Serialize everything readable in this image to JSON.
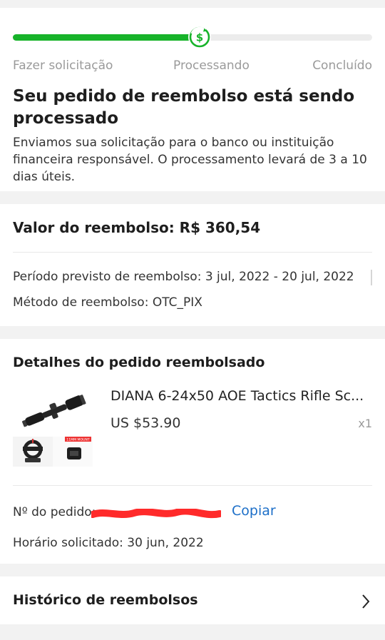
{
  "status": {
    "steps": [
      "Fazer solicitação",
      "Processando",
      "Concluído"
    ],
    "progress_fraction": 0.52,
    "title": "Seu pedido de reembolso está sendo processado",
    "description": "Enviamos sua solicitação para o banco ou instituição financeira responsável. O processamento levará de 3 a 10 dias úteis.",
    "icon": "dollar-refund-icon",
    "accent_color": "#17b32a"
  },
  "refund": {
    "amount_label": "Valor do reembolso: R$ 360,54",
    "period_label": "Período previsto de reembolso: 3 jul, 2022 - 20 jul, 2022",
    "method_label": "Método de reembolso: OTC_PIX"
  },
  "order": {
    "section_title": "Detalhes do pedido reembolsado",
    "product_name": "DIANA 6-24x50 AOE Tactics Rifle Sc...",
    "product_price": "US $53.90",
    "product_qty": "x1",
    "thumb_caption": "11MM MOUNT",
    "order_number_label": "Nº do pedido:",
    "copy_label": "Copiar",
    "requested_label": "Horário solicitado: 30 jun, 2022",
    "link_color": "#1d6fc8"
  },
  "history": {
    "title": "Histórico de reembolsos",
    "icon": "chevron-right-icon"
  }
}
